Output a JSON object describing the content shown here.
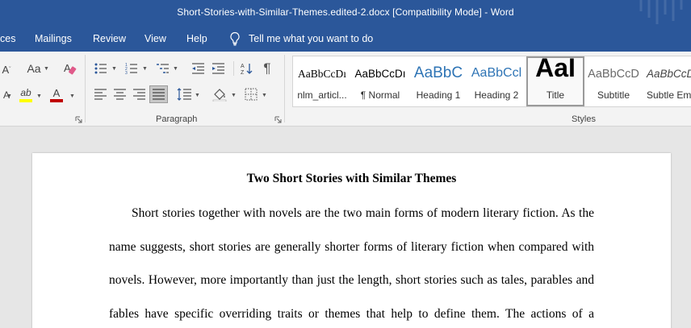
{
  "window": {
    "title": "Short-Stories-with-Similar-Themes.edited-2.docx [Compatibility Mode]  -  Word"
  },
  "tabs": [
    {
      "label": "ces"
    },
    {
      "label": "Mailings"
    },
    {
      "label": "Review"
    },
    {
      "label": "View"
    },
    {
      "label": "Help"
    }
  ],
  "tell_me": {
    "label": "Tell me what you want to do",
    "icon": "lightbulb-icon"
  },
  "ribbon": {
    "font_group": {
      "change_case_label": "Aa",
      "clear_format_label": "A",
      "grow_font_label": "A",
      "highlight_label": "ab",
      "font_color_label": "A",
      "font_color": "#c00000",
      "highlight_color": "#ffff00"
    },
    "paragraph_group": {
      "label": "Paragraph"
    },
    "styles_group": {
      "label": "Styles",
      "items": [
        {
          "preview": "AaBbCcDı",
          "name": "nlm_articl..."
        },
        {
          "preview": "AaBbCcDı",
          "name": "¶ Normal"
        },
        {
          "preview": "AaBbC",
          "name": "Heading 1"
        },
        {
          "preview": "AaBbCcl",
          "name": "Heading 2"
        },
        {
          "preview": "AaI",
          "name": "Title",
          "selected": true
        },
        {
          "preview": "AaBbCcD",
          "name": "Subtitle"
        },
        {
          "preview": "AaBbCcDı",
          "name": "Subtle Em..."
        }
      ]
    }
  },
  "document": {
    "heading": "Two Short Stories with Similar Themes",
    "lines": [
      "Short stories together with novels are the two main forms of modern literary fiction. As the",
      "name suggests, short stories are generally shorter forms of literary fiction when compared with",
      "novels. However, more importantly than just the length, short stories such as tales, parables and",
      "fables have specific overriding traits or themes that help to define them. The actions of a"
    ]
  },
  "colors": {
    "title_bar": "#2b579a",
    "ribbon": "#f3f3f3",
    "heading1_preview": "#2e74b5",
    "paragraph_mark": "#555555"
  }
}
